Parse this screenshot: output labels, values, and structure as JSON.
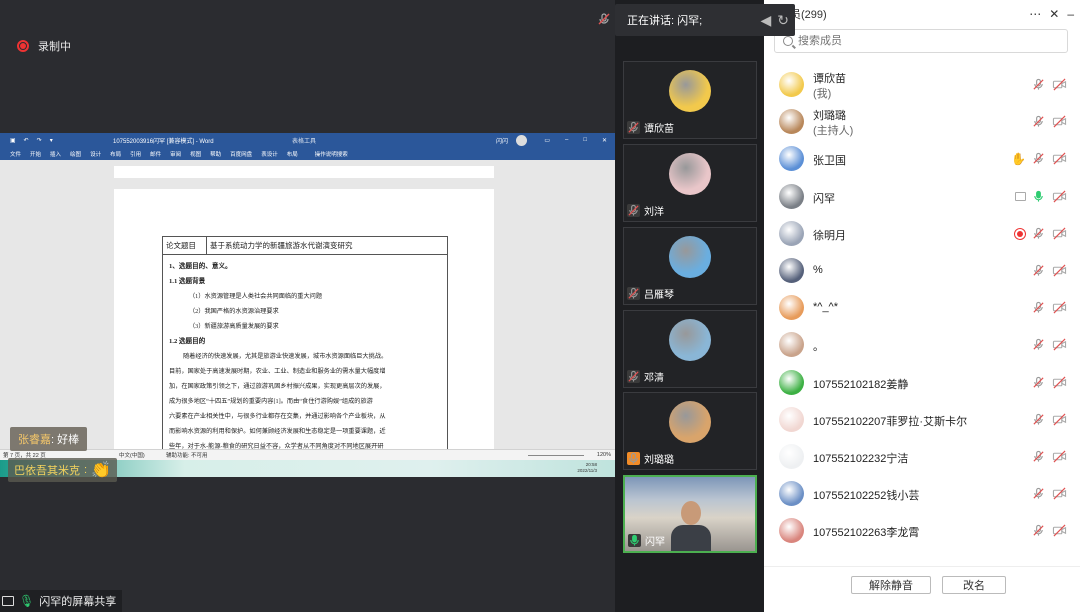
{
  "recording": {
    "label": "录制中"
  },
  "word": {
    "filename": "107552003916闪罕 [兼容模式] - Word",
    "context_tab": "表格工具",
    "user": "闪闪",
    "menu": [
      "文件",
      "开始",
      "插入",
      "绘图",
      "设计",
      "布局",
      "引用",
      "邮件",
      "审阅",
      "视图",
      "帮助",
      "百度网盘",
      "表设计",
      "布局",
      "操作说明搜索"
    ],
    "doc": {
      "head_label": "论文题目",
      "head_title": "基于系统动力学的新疆旅游水代谢演变研究",
      "sec1": "1、选题目的、意义。",
      "sec11": "1.1 选题背景",
      "items": [
        "（1）水资源管理是人类社会共同面临的重大问题",
        "（2）我国严格的水资源治理要求",
        "（3）新疆旅游高质量发展的要求"
      ],
      "sec12": "1.2 选题目的",
      "paragraph": [
        "随着经济的快速发展，尤其是旅游业快速发展，城市水资源面临巨大挑战。",
        "目前，国家处于高速发展时期，农业、工业、制造业和服务业的需水量大幅度增",
        "加，在国家政策引领之下，通过旅游巩固乡村振兴成果，实现更高层次的发展，",
        "成为很多地区“十四五”规划的重要内容[1]。而由“食住行游购娱”组成的旅游",
        "六要素在产业相关性中，与很多行业都存在交集，并通过影响各个产业板块，从",
        "而影响水资源的利用和保护。如何兼顾经济发展和生态稳定是一项重要课题，近",
        "些年，对于水-能源-粮食的研究日益不容，众学者从不同角度对不同地区展开研"
      ]
    },
    "status": {
      "page": "第 7 页，共 22 页",
      "words": "11272 个字",
      "lang": "中文(中国)",
      "access": "辅助功能: 不可用",
      "zoom": "120%"
    },
    "clock": {
      "time": "20:58",
      "date": "2022/11/3"
    }
  },
  "chat": [
    {
      "name": "张睿嘉",
      "sep": ": ",
      "text": "好棒"
    },
    {
      "name": "巴依吾其米克",
      "sep": ": ",
      "text": ""
    }
  ],
  "share_label": "闪罕的屏幕共享",
  "speaking": "正在讲话: 闪罕;",
  "tiles": [
    {
      "name": "谭欣苗",
      "color": "#f2c94c",
      "mic": "muted"
    },
    {
      "name": "刘洋",
      "color": "#e9c6c9",
      "mic": "muted"
    },
    {
      "name": "吕雁琴",
      "color": "#6aaee0",
      "mic": "muted"
    },
    {
      "name": "邓清",
      "color": "#8ab6d6",
      "mic": "muted"
    },
    {
      "name": "刘璐璐",
      "color": "#d9a46b",
      "mic": "host"
    },
    {
      "name": "闪罕",
      "color": "#7d96b8",
      "mic": "on"
    }
  ],
  "panel": {
    "title": "员(299)",
    "search_placeholder": "搜索成员",
    "members": [
      {
        "name": "谭欣苗",
        "sub": "(我)",
        "color": "#f2c94c",
        "hand": false,
        "rec": false,
        "mic": "muted"
      },
      {
        "name": "刘璐璐",
        "sub": "(主持人)",
        "color": "#b8875a",
        "hand": false,
        "rec": false,
        "mic": "muted"
      },
      {
        "name": "张卫国",
        "sub": "",
        "color": "#5b8fd6",
        "hand": true,
        "rec": false,
        "mic": "muted"
      },
      {
        "name": "闪罕",
        "sub": "",
        "color": "#7a7f86",
        "hand": false,
        "rec": false,
        "mic": "on"
      },
      {
        "name": "徐明月",
        "sub": "",
        "color": "#9aa4b6",
        "hand": false,
        "rec": true,
        "mic": "muted"
      },
      {
        "name": "%",
        "sub": "",
        "color": "#55607a",
        "hand": false,
        "rec": false,
        "mic": "muted"
      },
      {
        "name": "*^_^*",
        "sub": "",
        "color": "#e79b5a",
        "hand": false,
        "rec": false,
        "mic": "muted"
      },
      {
        "name": "。",
        "sub": "",
        "color": "#c9a38b",
        "hand": false,
        "rec": false,
        "mic": "muted"
      },
      {
        "name": "107552102182姜静",
        "sub": "",
        "color": "#3cb043",
        "hand": false,
        "rec": false,
        "mic": "muted"
      },
      {
        "name": "107552102207菲罗拉·艾斯卡尔",
        "sub": "",
        "color": "#f1d7d2",
        "hand": false,
        "rec": false,
        "mic": "muted"
      },
      {
        "name": "107552102232宁洁",
        "sub": "",
        "color": "#eef0f2",
        "hand": false,
        "rec": false,
        "mic": "muted"
      },
      {
        "name": "107552102252钱小芸",
        "sub": "",
        "color": "#6b8fc5",
        "hand": false,
        "rec": false,
        "mic": "muted"
      },
      {
        "name": "107552102263李龙霄",
        "sub": "",
        "color": "#d9857d",
        "hand": false,
        "rec": false,
        "mic": "muted"
      }
    ],
    "unmute_label": "解除静音",
    "rename_label": "改名"
  },
  "colors": {
    "word_blue": "#2b579a",
    "muted_red": "#e05252",
    "mic_green": "#2ecc71",
    "hand_blue": "#2f6fe4",
    "rec_red": "#e33"
  }
}
